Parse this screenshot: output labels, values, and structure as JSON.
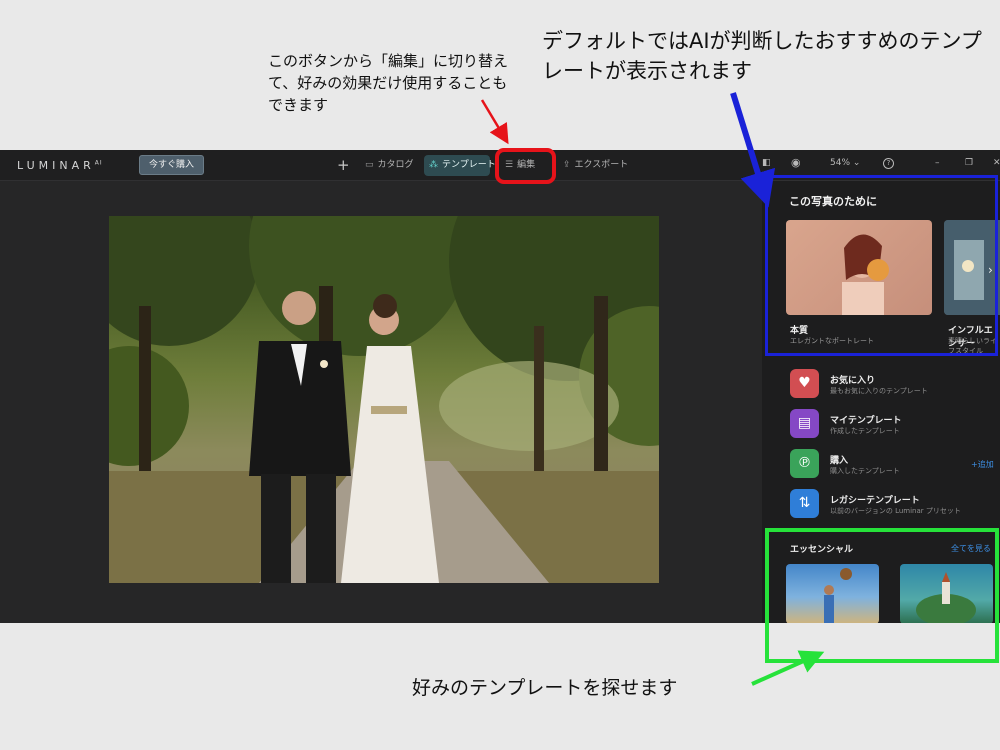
{
  "annotations": {
    "edit_note": "このボタンから「編集」に切り替えて、好みの効果だけ使用することもできます",
    "ai_note": "デフォルトではAIが判断したおすすめのテンプレートが表示されます",
    "find_note": "好みのテンプレートを探せます"
  },
  "topbar": {
    "logo": "LUMINAR",
    "logo_sup": "AI",
    "buy_label": "今すぐ購入",
    "add_glyph": "+",
    "nav_catalog": "カタログ",
    "nav_templates": "テンプレート",
    "nav_edit": "編集",
    "nav_export": "エクスポート",
    "zoom": "54%",
    "zoom_chevron": "⌄",
    "help_glyph": "?",
    "min_glyph": "–",
    "max_glyph": "❐",
    "close_glyph": "✕"
  },
  "side_panel": {
    "title": "この写真のために",
    "cards": [
      {
        "title": "本質",
        "subtitle": "エレガントなポートレート"
      },
      {
        "title": "インフルエンサー",
        "subtitle": "素晴らしいライフスタイル"
      }
    ],
    "collections": [
      {
        "title": "お気に入り",
        "subtitle": "最もお気に入りのテンプレート",
        "icon": "heart-icon"
      },
      {
        "title": "マイテンプレート",
        "subtitle": "作成したテンプレート",
        "icon": "template-icon"
      },
      {
        "title": "購入",
        "subtitle": "購入したテンプレート",
        "icon": "purchase-icon"
      },
      {
        "title": "レガシーテンプレート",
        "subtitle": "以前のバージョンの Luminar プリセット",
        "icon": "legacy-arrows-icon"
      }
    ],
    "add_link": "+追加",
    "essentials_title": "エッセンシャル",
    "see_all": "全てを見る"
  },
  "colors": {
    "highlight_red": "#e6131a",
    "highlight_blue": "#1a22d8",
    "highlight_green": "#26e23a",
    "accent_teal": "#2e4b51",
    "link_blue": "#3d8fe4"
  }
}
